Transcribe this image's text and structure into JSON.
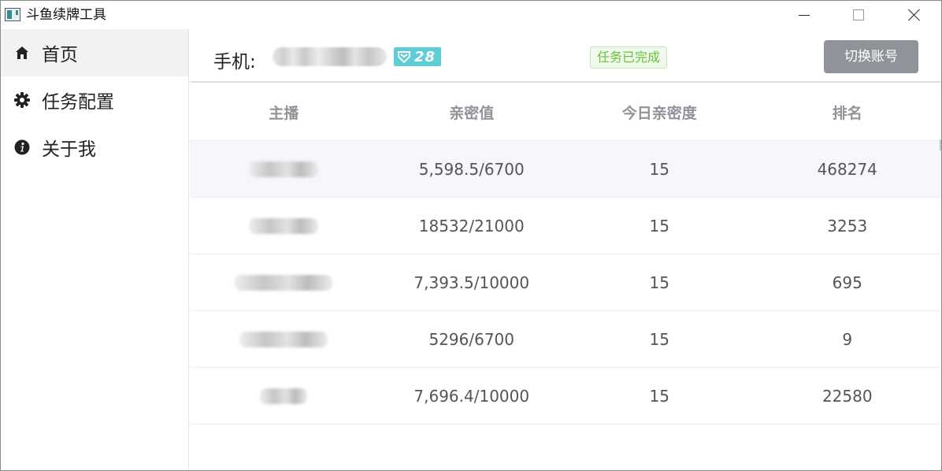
{
  "window": {
    "title": "斗鱼续牌工具"
  },
  "sidebar": {
    "items": [
      {
        "label": "首页",
        "icon": "home-icon",
        "active": true
      },
      {
        "label": "任务配置",
        "icon": "gear-icon",
        "active": false
      },
      {
        "label": "关于我",
        "icon": "info-icon",
        "active": false
      }
    ]
  },
  "header": {
    "phone_label": "手机:",
    "level": "28",
    "status": "任务已完成",
    "switch_button": "切换账号"
  },
  "table": {
    "columns": [
      "主播",
      "亲密值",
      "今日亲密度",
      "排名"
    ],
    "rows": [
      {
        "intimacy": "5,598.5/6700",
        "today": "15",
        "rank": "468274"
      },
      {
        "intimacy": "18532/21000",
        "today": "15",
        "rank": "3253"
      },
      {
        "intimacy": "7,393.5/10000",
        "today": "15",
        "rank": "695"
      },
      {
        "intimacy": "5296/6700",
        "today": "15",
        "rank": "9"
      },
      {
        "intimacy": "7,696.4/10000",
        "today": "15",
        "rank": "22580"
      }
    ]
  },
  "colors": {
    "level_badge": "#5ecdd6",
    "status_text": "#67c23a",
    "switch_button_bg": "#909399",
    "active_nav_bg": "#f2f2f2"
  }
}
